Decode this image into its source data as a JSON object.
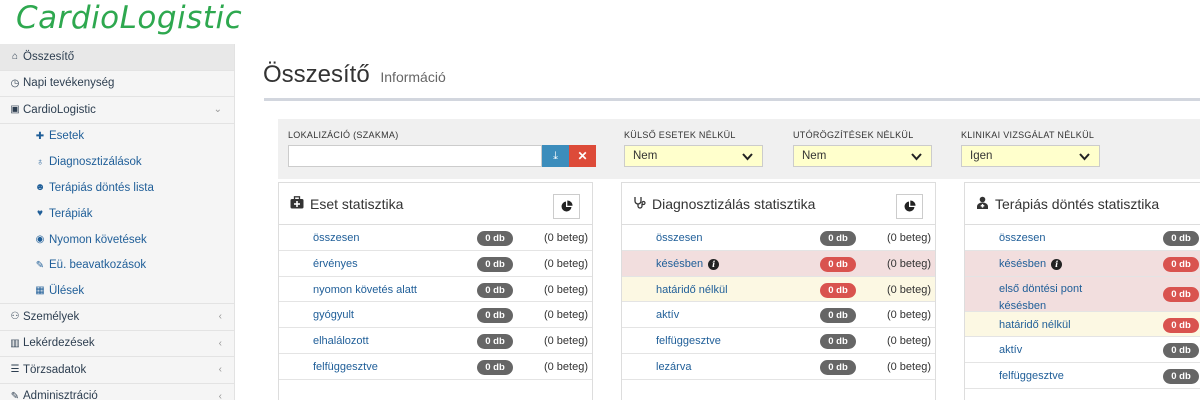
{
  "app": {
    "logo": "CardioLogistic"
  },
  "sidebar": {
    "items": [
      {
        "label": "Összesítő",
        "icon": "dashboard-icon",
        "glyph": "⌂"
      },
      {
        "label": "Napi tevékenység",
        "icon": "clock-icon",
        "glyph": "◷"
      },
      {
        "label": "CardioLogistic",
        "icon": "save-icon",
        "glyph": "▣"
      },
      {
        "label": "Személyek",
        "icon": "users-icon",
        "glyph": "⚇"
      },
      {
        "label": "Lekérdezések",
        "icon": "bar-chart-icon",
        "glyph": "▥"
      },
      {
        "label": "Törzsadatok",
        "icon": "list-icon",
        "glyph": "☰"
      },
      {
        "label": "Adminisztráció",
        "icon": "wrench-icon",
        "glyph": "✎"
      }
    ],
    "sub": [
      {
        "label": "Esetek",
        "icon": "medkit-icon",
        "glyph": "✚"
      },
      {
        "label": "Diagnosztizálások",
        "icon": "stethoscope-icon",
        "glyph": "♁"
      },
      {
        "label": "Terápiás döntés lista",
        "icon": "user-md-icon",
        "glyph": "☻"
      },
      {
        "label": "Terápiák",
        "icon": "heart-icon",
        "glyph": "♥"
      },
      {
        "label": "Nyomon követések",
        "icon": "eye-icon",
        "glyph": "◉"
      },
      {
        "label": "Eü. beavatkozások",
        "icon": "edit-icon",
        "glyph": "✎"
      },
      {
        "label": "Ülések",
        "icon": "calendar-icon",
        "glyph": "▦"
      }
    ]
  },
  "page": {
    "title": "Összesítő",
    "subtitle": "Információ"
  },
  "filters": {
    "location_label": "LOKALIZÁCIÓ (SZAKMA)",
    "location_value": "",
    "external_label": "KÜLSŐ ESETEK NÉLKÜL",
    "external_value": "Nem",
    "post_label": "UTÓRÖGZÍTÉSEK NÉLKÜL",
    "post_value": "Nem",
    "clinical_label": "KLINIKAI VIZSGÁLAT NÉLKÜL",
    "clinical_value": "Igen"
  },
  "panels": [
    {
      "title": "Eset statisztika",
      "icon": "medkit-icon",
      "rows": [
        {
          "label": "összesen",
          "badge": "0 db",
          "count": "(0 beteg)"
        },
        {
          "label": "érvényes",
          "badge": "0 db",
          "count": "(0 beteg)"
        },
        {
          "label": "nyomon követés alatt",
          "badge": "0 db",
          "count": "(0 beteg)"
        },
        {
          "label": "gyógyult",
          "badge": "0 db",
          "count": "(0 beteg)"
        },
        {
          "label": "elhalálozott",
          "badge": "0 db",
          "count": "(0 beteg)"
        },
        {
          "label": "felfüggesztve",
          "badge": "0 db",
          "count": "(0 beteg)"
        }
      ]
    },
    {
      "title": "Diagnosztizálás statisztika",
      "icon": "stethoscope-icon",
      "rows": [
        {
          "label": "összesen",
          "badge": "0 db",
          "count": "(0 beteg)"
        },
        {
          "label": "késésben",
          "badge": "0 db",
          "count": "(0 beteg)"
        },
        {
          "label": "határidő nélkül",
          "badge": "0 db",
          "count": "(0 beteg)"
        },
        {
          "label": "aktív",
          "badge": "0 db",
          "count": "(0 beteg)"
        },
        {
          "label": "felfüggesztve",
          "badge": "0 db",
          "count": "(0 beteg)"
        },
        {
          "label": "lezárva",
          "badge": "0 db",
          "count": "(0 beteg)"
        }
      ]
    },
    {
      "title": "Terápiás döntés statisztika",
      "icon": "user-md-icon",
      "rows": [
        {
          "label": "összesen",
          "badge": "0 db"
        },
        {
          "label": "késésben",
          "badge": "0 db"
        },
        {
          "label": "első döntési pont",
          "label2": "késésben",
          "badge": "0 db"
        },
        {
          "label": "határidő nélkül",
          "badge": "0 db"
        },
        {
          "label": "aktív",
          "badge": "0 db"
        },
        {
          "label": "felfüggesztve",
          "badge": "0 db"
        }
      ]
    }
  ],
  "colors": {
    "brand": "#2ea84f",
    "link": "#1f5e98",
    "danger": "#d9534f",
    "primary": "#3c8dbc"
  }
}
